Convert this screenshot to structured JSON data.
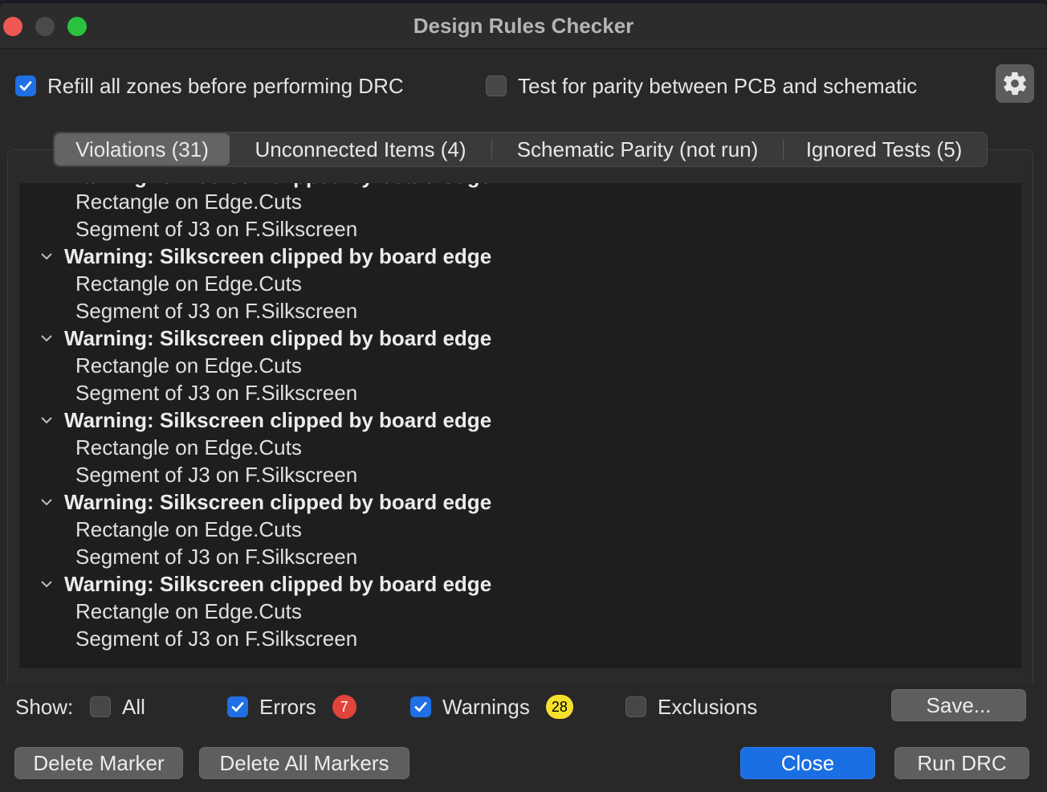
{
  "window": {
    "title": "Design Rules Checker"
  },
  "options": {
    "refill_zones": {
      "label": "Refill all zones before performing DRC",
      "checked": true
    },
    "test_parity": {
      "label": "Test for parity between PCB and schematic",
      "checked": false
    }
  },
  "tabs": [
    {
      "label": "Violations (31)",
      "active": true
    },
    {
      "label": "Unconnected Items (4)",
      "active": false
    },
    {
      "label": "Schematic Parity (not run)",
      "active": false
    },
    {
      "label": "Ignored Tests (5)",
      "active": false
    }
  ],
  "tree": {
    "partial_top_children": [
      "Rectangle on Edge.Cuts",
      "Segment of J3 on F.Silkscreen"
    ],
    "groups": [
      {
        "title": "Warning: Silkscreen clipped by board edge",
        "items": [
          "Rectangle on Edge.Cuts",
          "Segment of J3 on F.Silkscreen"
        ]
      },
      {
        "title": "Warning: Silkscreen clipped by board edge",
        "items": [
          "Rectangle on Edge.Cuts",
          "Segment of J3 on F.Silkscreen"
        ]
      },
      {
        "title": "Warning: Silkscreen clipped by board edge",
        "items": [
          "Rectangle on Edge.Cuts",
          "Segment of J3 on F.Silkscreen"
        ]
      },
      {
        "title": "Warning: Silkscreen clipped by board edge",
        "items": [
          "Rectangle on Edge.Cuts",
          "Segment of J3 on F.Silkscreen"
        ]
      },
      {
        "title": "Warning: Silkscreen clipped by board edge",
        "items": [
          "Rectangle on Edge.Cuts",
          "Segment of J3 on F.Silkscreen"
        ]
      }
    ]
  },
  "filters": {
    "show_label": "Show:",
    "all": {
      "label": "All",
      "checked": false
    },
    "errors": {
      "label": "Errors",
      "checked": true,
      "count": "7"
    },
    "warnings": {
      "label": "Warnings",
      "checked": true,
      "count": "28"
    },
    "exclusions": {
      "label": "Exclusions",
      "checked": false
    }
  },
  "buttons": {
    "save": "Save...",
    "delete_marker": "Delete Marker",
    "delete_all_markers": "Delete All Markers",
    "close": "Close",
    "run_drc": "Run DRC"
  },
  "colors": {
    "accent": "#1f6fe5",
    "error_badge": "#e0443a",
    "warning_badge": "#f5e02e"
  },
  "icons": {
    "settings": "gear-icon",
    "expand": "chevron-down-icon",
    "check": "checkmark-icon"
  }
}
